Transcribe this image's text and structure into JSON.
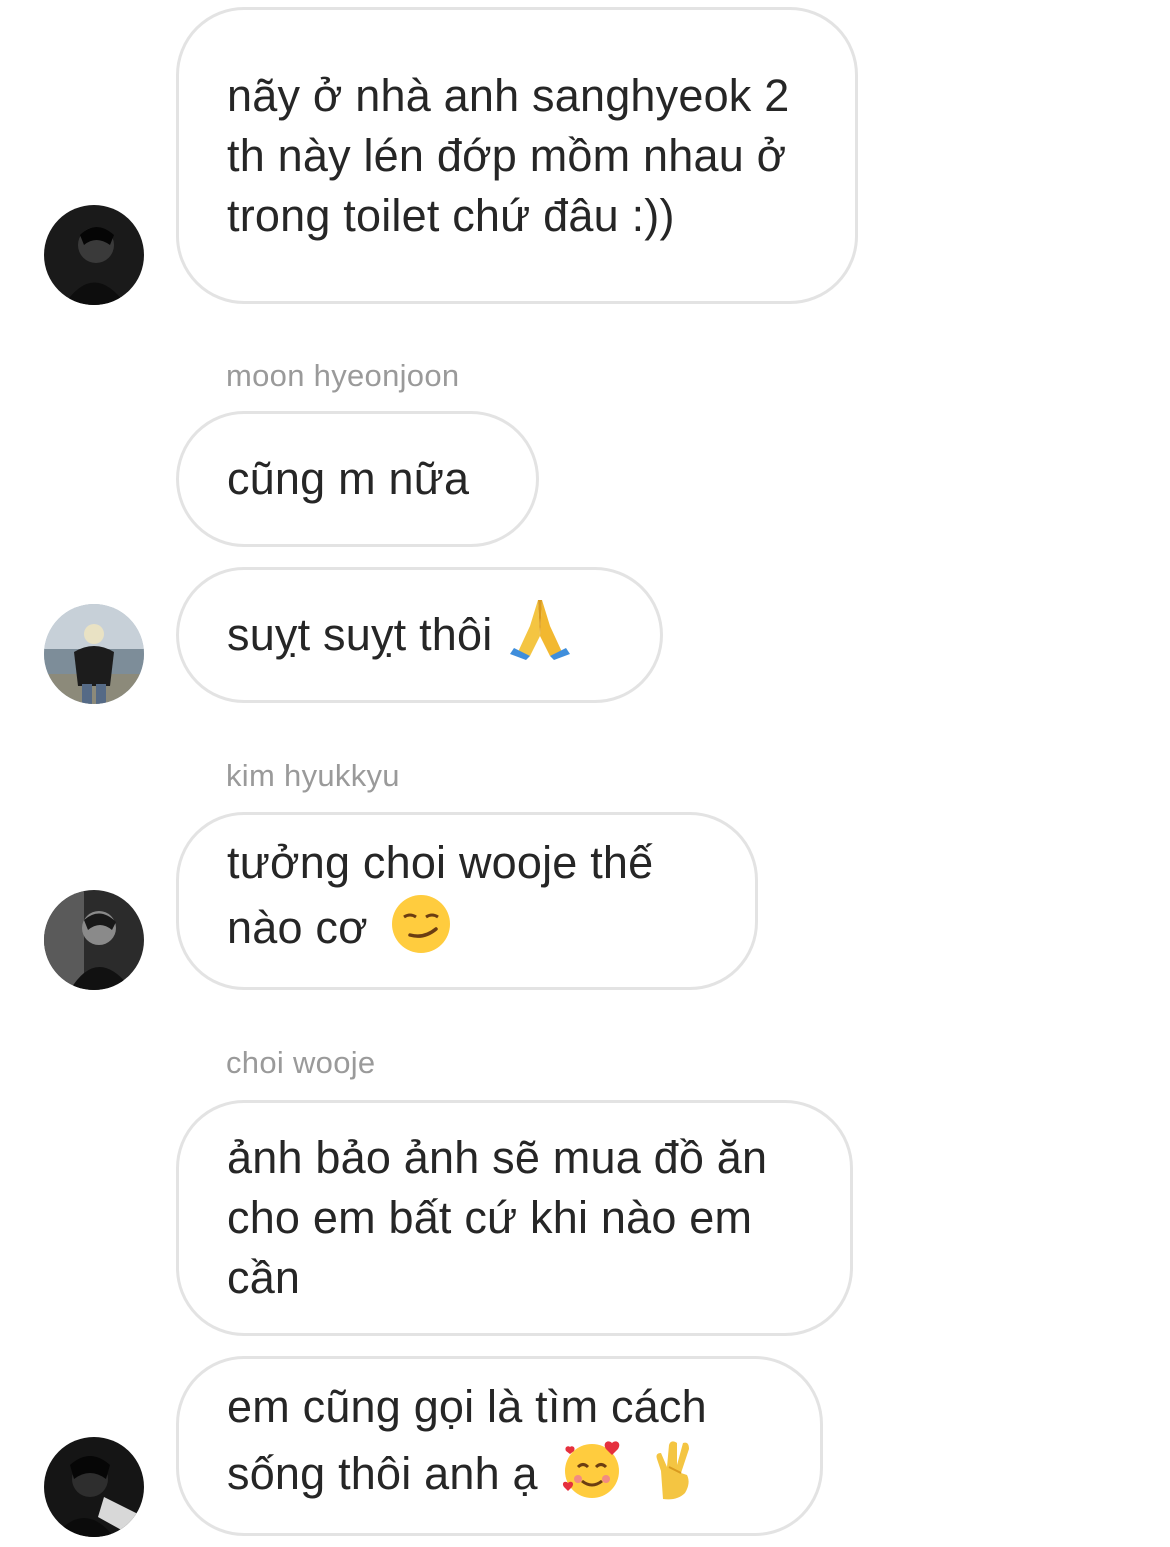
{
  "messages": [
    {
      "text": "nãy ở nhà anh sanghyeok 2 th này lén đớp mồm nhau ở trong toilet chứ đâu :))"
    },
    {
      "sender": "moon hyeonjoon",
      "text": "cũng m nữa"
    },
    {
      "text": "suỵt suỵt thôi",
      "emoji": "folded-hands-icon"
    },
    {
      "sender": "kim hyukkyu",
      "text": "tưởng choi wooje thế nào cơ",
      "emoji": "smirking-face-icon"
    },
    {
      "sender": "choi wooje",
      "text": "ảnh bảo ảnh sẽ mua đồ ăn cho em bất cứ khi nào em cần"
    },
    {
      "text": "em cũng gọi là tìm cách sống thôi anh ạ",
      "emojis": [
        "smiling-face-with-hearts-icon",
        "crossed-fingers-icon"
      ]
    }
  ],
  "colors": {
    "bubble_border": "#e3e3e3",
    "sender_text": "#9a9a9a",
    "message_text": "#262626"
  }
}
